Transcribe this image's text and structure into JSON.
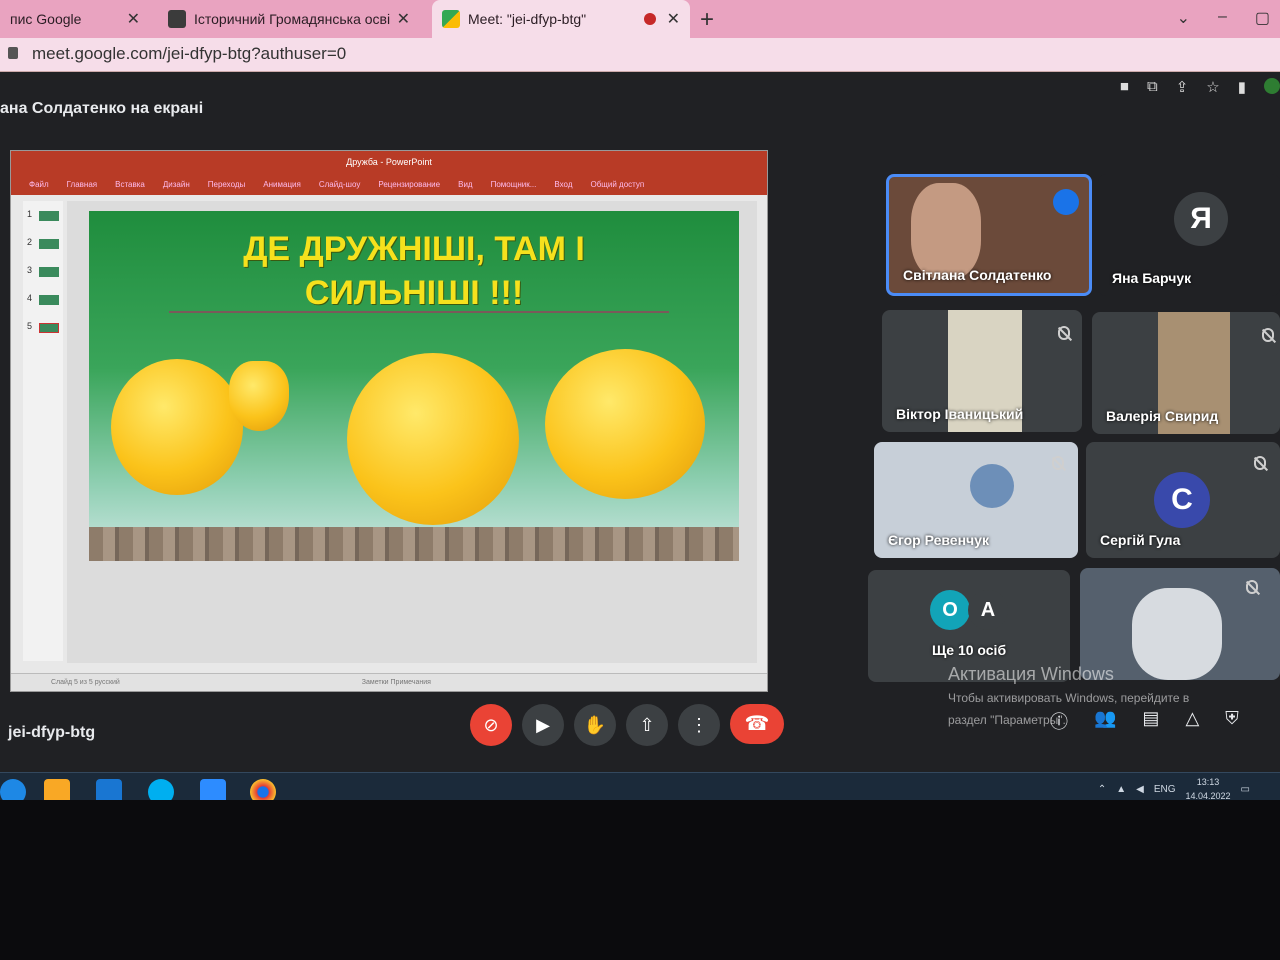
{
  "browser": {
    "tabs": [
      {
        "title": "пис Google",
        "close": "✕"
      },
      {
        "title": "Історичний Громадянська осві",
        "close": "✕"
      },
      {
        "title": "Meet: \"jei-dfyp-btg\"",
        "close": "✕"
      }
    ],
    "new_tab": "+",
    "url": "meet.google.com/jei-dfyp-btg?authuser=0"
  },
  "meet": {
    "presenter_banner": "ана Солдатенко на екрані",
    "meeting_code": "jei-dfyp-btg"
  },
  "powerpoint": {
    "window_title": "Дружба - PowerPoint",
    "ribbon_tabs": [
      "Файл",
      "Главная",
      "Вставка",
      "Дизайн",
      "Переходы",
      "Анимация",
      "Слайд-шоу",
      "Рецензирование",
      "Вид",
      "Помощник...",
      "Вход",
      "Общий доступ"
    ],
    "slide_numbers": [
      "1",
      "2",
      "3",
      "4",
      "5"
    ],
    "status_left": "Слайд 5 из 5   русский",
    "status_right": "Заметки   Примечания",
    "slide": {
      "title_line1": "ДЕ ДРУЖНІШІ, ТАМ І",
      "title_line2": "СИЛЬНІШІ !!!"
    }
  },
  "participants": [
    {
      "name": "Світлана Солдатенко",
      "speaking": true
    },
    {
      "name": "Яна Барчук",
      "initial": "Я"
    },
    {
      "name": "Віктор Іваницький"
    },
    {
      "name": "Валерія Свирид"
    },
    {
      "name": "Єгор Ревенчук"
    },
    {
      "name": "Сергій Гула",
      "initial": "С",
      "avatar_color": "#3949ab"
    },
    {
      "name": "Ще 10 осіб",
      "initials": [
        "О",
        "А"
      ]
    }
  ],
  "activation": {
    "line1": "Активация Windows",
    "line2": "Чтобы активировать Windows, перейдите в",
    "line3": "раздел \"Параметры\"."
  },
  "taskbar": {
    "lang": "ENG",
    "time": "13:13",
    "date": "14.04.2022"
  },
  "colors": {
    "tab_strip": "#e9a3c0",
    "meet_bg": "#202124",
    "end_call": "#ea4335",
    "ppt_accent": "#b83b26",
    "slide_title": "#f6e11d"
  }
}
